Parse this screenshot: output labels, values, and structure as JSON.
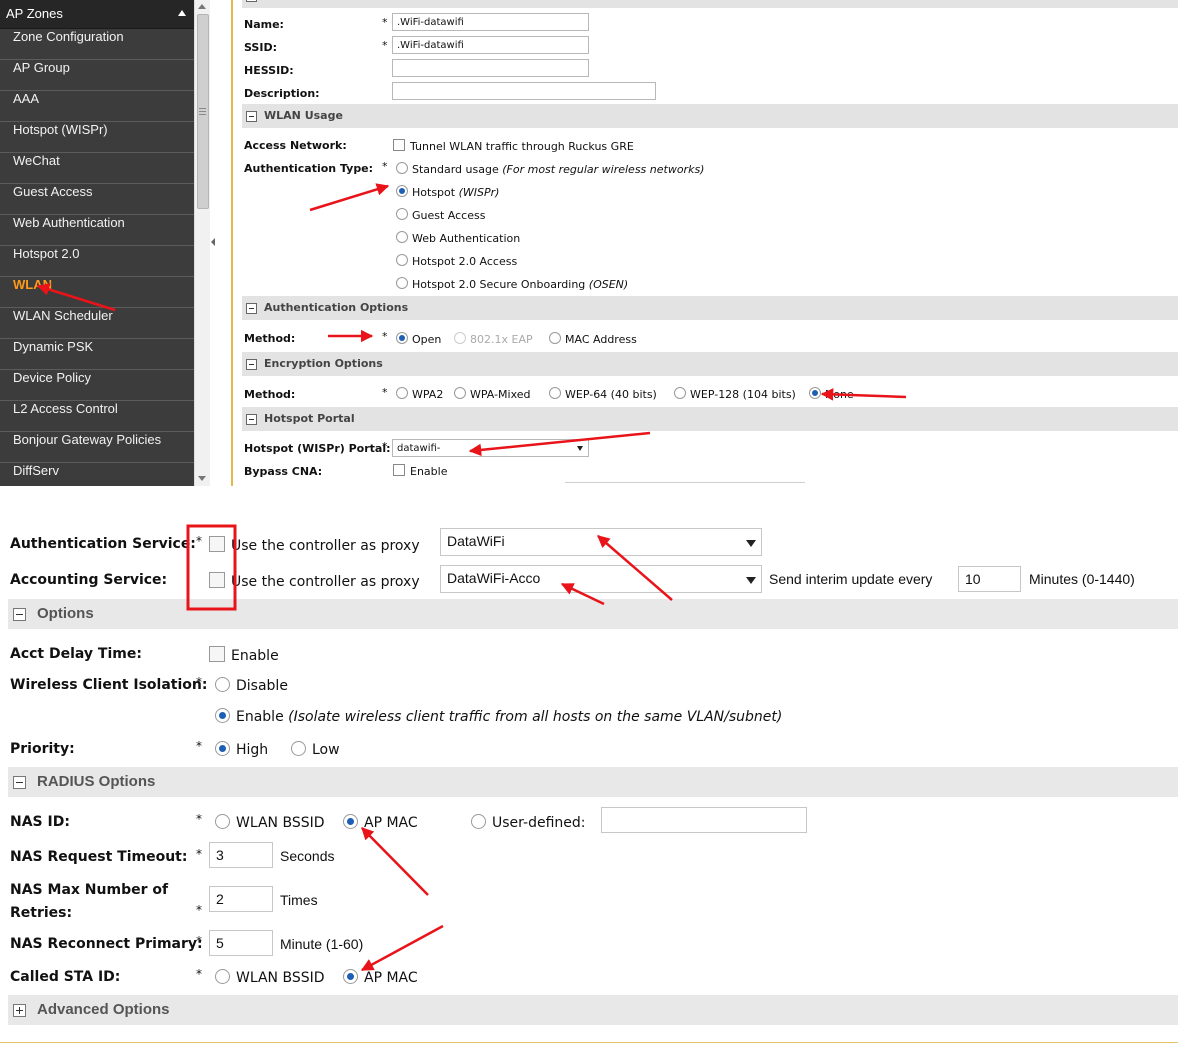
{
  "colors": {
    "sidebar_bg": "#3c3c3c",
    "active_item": "#ff9a1a",
    "selected_radio": "#1e5fb5",
    "annotation_red": "#e8141a",
    "divider_gold": "#e4b84a"
  },
  "sidebar": {
    "header": "AP Zones",
    "items": [
      {
        "label": "Zone Configuration"
      },
      {
        "label": "AP Group"
      },
      {
        "label": "AAA"
      },
      {
        "label": "Hotspot (WISPr)"
      },
      {
        "label": "WeChat"
      },
      {
        "label": "Guest Access"
      },
      {
        "label": "Web Authentication"
      },
      {
        "label": "Hotspot 2.0"
      },
      {
        "label": "WLAN",
        "active": true
      },
      {
        "label": "WLAN Scheduler"
      },
      {
        "label": "Dynamic PSK"
      },
      {
        "label": "Device Policy"
      },
      {
        "label": "L2 Access Control"
      },
      {
        "label": "Bonjour Gateway Policies"
      },
      {
        "label": "DiffServ"
      }
    ]
  },
  "general": {
    "name_label": "Name:",
    "name_value": ".WiFi-datawifi",
    "ssid_label": "SSID:",
    "ssid_value": ".WiFi-datawifi",
    "hessid_label": "HESSID:",
    "hessid_value": "",
    "description_label": "Description:",
    "description_value": "",
    "required": "*"
  },
  "wlan_usage": {
    "title": "WLAN Usage",
    "access_network_label": "Access Network:",
    "tunnel_label": "Tunnel WLAN traffic through Ruckus GRE",
    "auth_type_label": "Authentication Type:",
    "standard_usage": "Standard usage",
    "standard_usage_note": "(For most regular wireless networks)",
    "hotspot": "Hotspot",
    "hotspot_note": "(WISPr)",
    "guest_access": "Guest Access",
    "web_auth": "Web Authentication",
    "hotspot20": "Hotspot 2.0 Access",
    "hotspot20_secure": "Hotspot 2.0 Secure Onboarding",
    "hotspot20_secure_note": "(OSEN)",
    "selected": "Hotspot (WISPr)"
  },
  "auth_options": {
    "title": "Authentication Options",
    "method_label": "Method:",
    "open": "Open",
    "eap": "802.1x EAP",
    "mac": "MAC Address",
    "selected": "Open"
  },
  "encryption": {
    "title": "Encryption Options",
    "method_label": "Method:",
    "wpa2": "WPA2",
    "wpa_mixed": "WPA-Mixed",
    "wep64": "WEP-64 (40 bits)",
    "wep128": "WEP-128 (104 bits)",
    "none": "None",
    "selected": "None"
  },
  "hotspot_portal": {
    "title": "Hotspot Portal",
    "portal_label": "Hotspot (WISPr) Portal:",
    "portal_value": "datawifi-",
    "bypass_label": "Bypass CNA:",
    "bypass_enable": "Enable"
  },
  "services": {
    "auth_label": "Authentication Service:",
    "acct_label": "Accounting Service:",
    "proxy_label": "Use the controller as proxy",
    "auth_value": "DataWiFi",
    "acct_value": "DataWiFi-Acco",
    "interim_label": "Send interim update every",
    "interim_value": "10",
    "interim_unit": "Minutes (0-1440)"
  },
  "options": {
    "title": "Options",
    "acct_delay_label": "Acct Delay Time:",
    "enable": "Enable",
    "isolation_label": "Wireless Client Isolation:",
    "disable": "Disable",
    "isolation_enable": "Enable",
    "isolation_note": "(Isolate wireless client traffic from all hosts on the same VLAN/subnet)",
    "priority_label": "Priority:",
    "high": "High",
    "low": "Low"
  },
  "radius": {
    "title": "RADIUS Options",
    "nas_id_label": "NAS ID:",
    "wlan_bssid": "WLAN BSSID",
    "ap_mac": "AP MAC",
    "user_defined": "User-defined:",
    "user_defined_value": "",
    "timeout_label": "NAS Request Timeout:",
    "timeout_value": "3",
    "timeout_unit": "Seconds",
    "retries_label_1": "NAS Max Number of",
    "retries_label_2": "Retries:",
    "retries_value": "2",
    "retries_unit": "Times",
    "reconnect_label": "NAS Reconnect Primary:",
    "reconnect_value": "5",
    "reconnect_unit": "Minute (1-60)",
    "called_sta_label": "Called STA ID:",
    "required": "*"
  },
  "advanced": {
    "title": "Advanced Options"
  }
}
